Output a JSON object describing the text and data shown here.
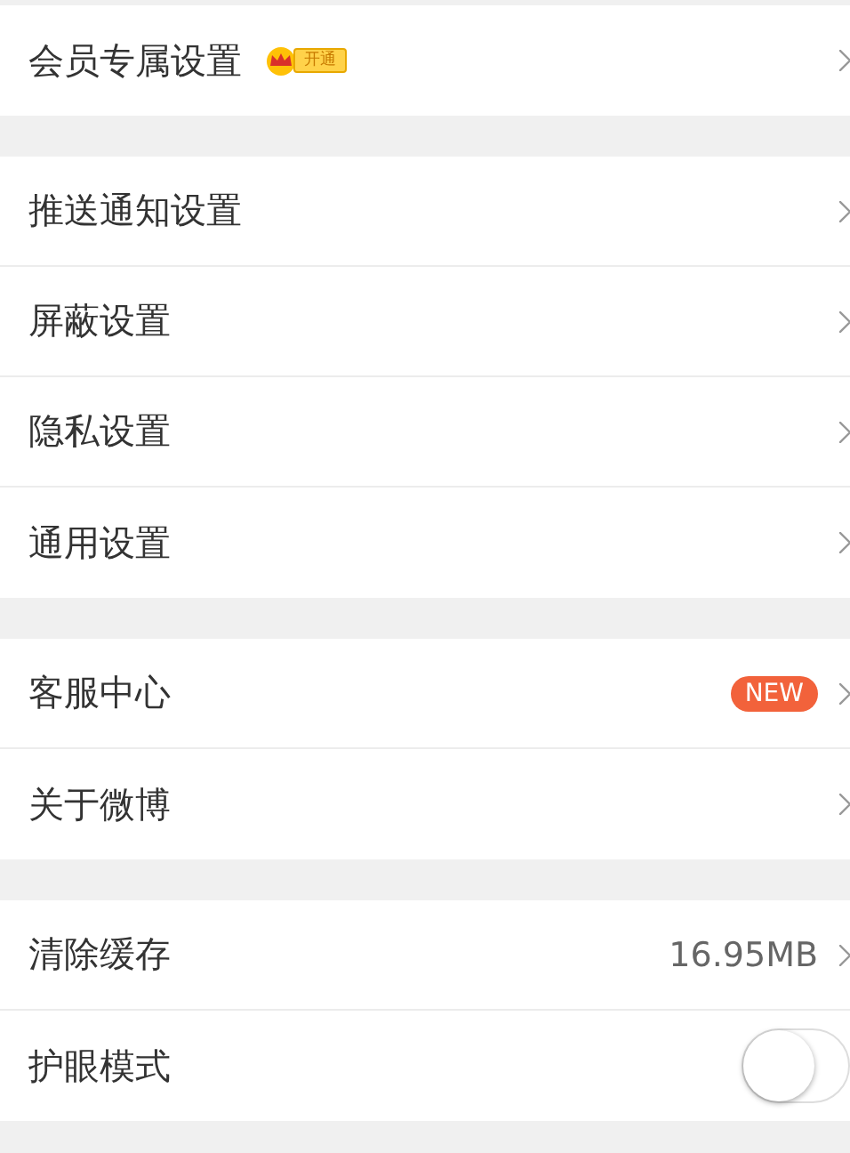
{
  "sections": [
    {
      "rows": [
        {
          "kind": "vip",
          "label": "会员专属设置",
          "badge": "开通"
        }
      ]
    },
    {
      "rows": [
        {
          "kind": "link",
          "label": "推送通知设置"
        },
        {
          "kind": "link",
          "label": "屏蔽设置"
        },
        {
          "kind": "link",
          "label": "隐私设置"
        },
        {
          "kind": "link",
          "label": "通用设置"
        }
      ]
    },
    {
      "rows": [
        {
          "kind": "new",
          "label": "客服中心",
          "badge": "NEW"
        },
        {
          "kind": "link",
          "label": "关于微博"
        }
      ]
    },
    {
      "rows": [
        {
          "kind": "value",
          "label": "清除缓存",
          "value": "16.95MB"
        },
        {
          "kind": "toggle",
          "label": "护眼模式",
          "on": false
        }
      ]
    }
  ]
}
